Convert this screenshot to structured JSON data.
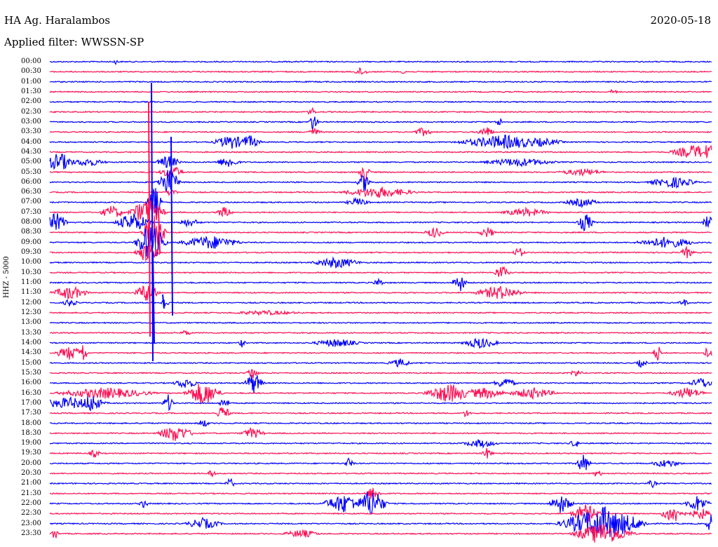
{
  "header": {
    "station": "HA Ag. Haralambos",
    "date": "2020-05-18",
    "filter_text": "Applied filter: WWSSN-SP"
  },
  "axis": {
    "channel_label": "HHZ - 5000"
  },
  "colors": {
    "even_trace": "#0000ff",
    "odd_trace": "#ff1155",
    "background": "#ffffff"
  },
  "time_labels": [
    "00:00",
    "00:30",
    "01:00",
    "01:30",
    "02:00",
    "02:30",
    "03:00",
    "03:30",
    "04:00",
    "04:30",
    "05:00",
    "05:30",
    "06:00",
    "06:30",
    "07:00",
    "07:30",
    "08:00",
    "08:30",
    "09:00",
    "09:30",
    "10:00",
    "10:30",
    "11:00",
    "11:30",
    "12:00",
    "12:30",
    "13:00",
    "13:30",
    "14:00",
    "14:30",
    "15:00",
    "15:30",
    "16:00",
    "16:30",
    "17:00",
    "17:30",
    "18:00",
    "18:30",
    "19:00",
    "19:30",
    "20:00",
    "20:30",
    "21:00",
    "21:30",
    "22:00",
    "22:30",
    "23:00",
    "23:30"
  ]
}
